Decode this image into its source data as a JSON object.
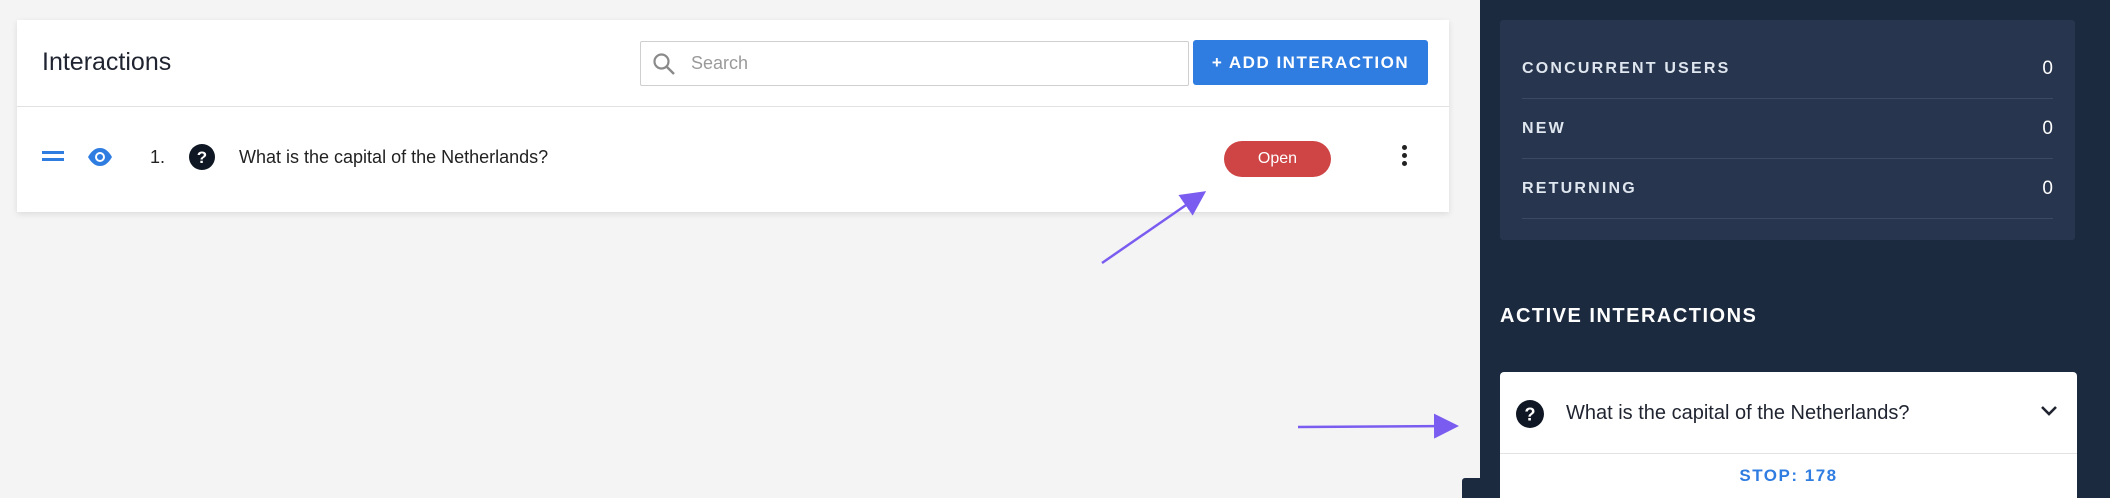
{
  "panel": {
    "title": "Interactions",
    "search_placeholder": "Search",
    "add_button_label": "+ ADD INTERACTION"
  },
  "interactions": [
    {
      "number": "1.",
      "question": "What is the capital of the Netherlands?",
      "status": "Open"
    }
  ],
  "sidebar": {
    "stats": [
      {
        "label": "CONCURRENT USERS",
        "value": "0"
      },
      {
        "label": "NEW",
        "value": "0"
      },
      {
        "label": "RETURNING",
        "value": "0"
      }
    ],
    "active_title": "ACTIVE INTERACTIONS",
    "active_item": {
      "question": "What is the capital of the Netherlands?",
      "stop_label": "STOP: 178"
    }
  },
  "colors": {
    "accent": "#2f7de1",
    "open_status": "#cf4444",
    "sidebar_bg": "#1c2a40",
    "annotation_arrow": "#7b5cf0"
  },
  "icons": [
    "search-icon",
    "drag-handle-icon",
    "eye-icon",
    "question-icon",
    "more-vert-icon",
    "chevron-down-icon"
  ]
}
